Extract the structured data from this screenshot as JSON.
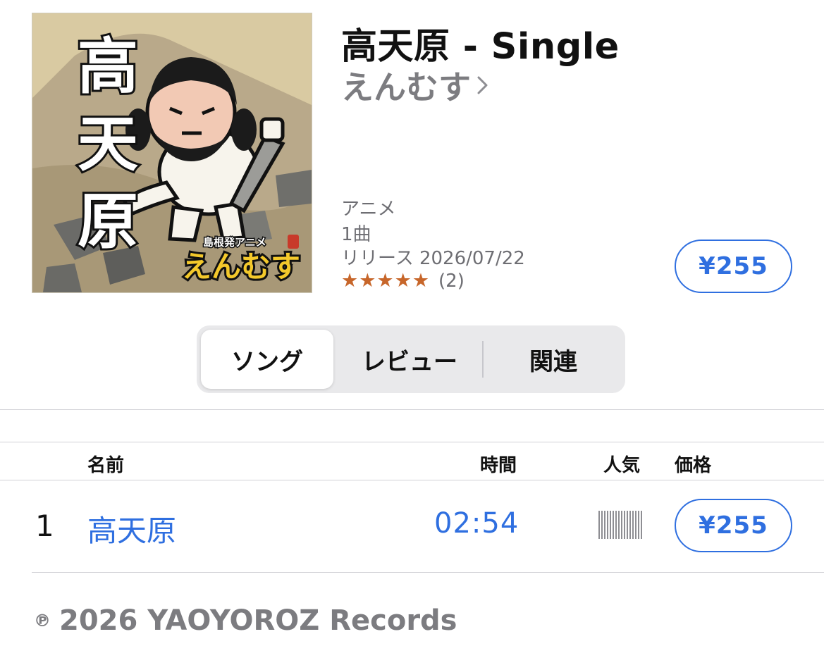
{
  "album": {
    "title": "高天原 - Single",
    "artist": "えんむす",
    "genre": "アニメ",
    "track_count": "1曲",
    "release": "リリース 2026/07/22",
    "stars": "★★★★★",
    "rating_count": "(2)",
    "rating_value": 5,
    "price": "¥255"
  },
  "artwork": {
    "title_text": "高天原",
    "caption_small": "島根発アニメ",
    "caption_logo": "えんむす"
  },
  "segmented": {
    "songs": "ソング",
    "reviews": "レビュー",
    "related": "関連",
    "selected": "songs"
  },
  "table": {
    "headers": {
      "name": "名前",
      "time": "時間",
      "popularity": "人気",
      "price": "価格"
    },
    "rows": [
      {
        "number": "1",
        "name": "高天原",
        "time": "02:54",
        "price": "¥255"
      }
    ]
  },
  "footer": {
    "copyright_symbol": "℗",
    "copyright": "2026 YAOYOROZ Records"
  },
  "colors": {
    "accent": "#2f6fe0",
    "star": "#c7662a",
    "secondary_text": "#6e6e73"
  }
}
